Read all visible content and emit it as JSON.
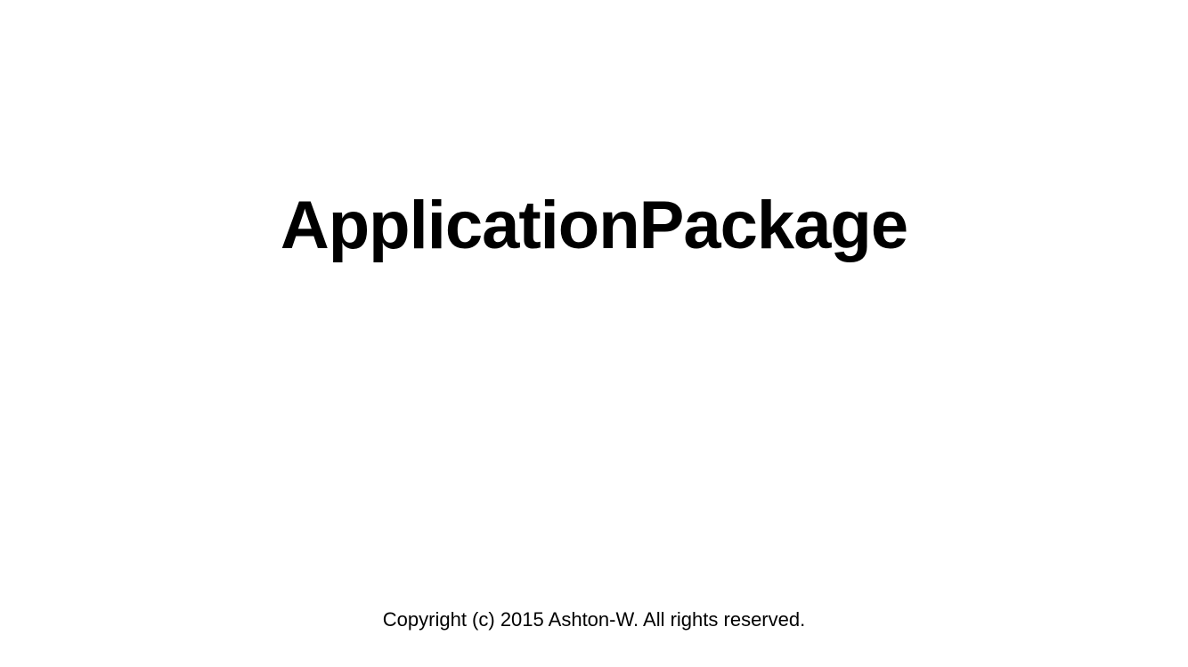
{
  "launch_screen": {
    "title": "ApplicationPackage",
    "copyright": "Copyright (c) 2015 Ashton-W. All rights reserved."
  },
  "colors": {
    "background": "#ffffff",
    "text": "#000000"
  }
}
